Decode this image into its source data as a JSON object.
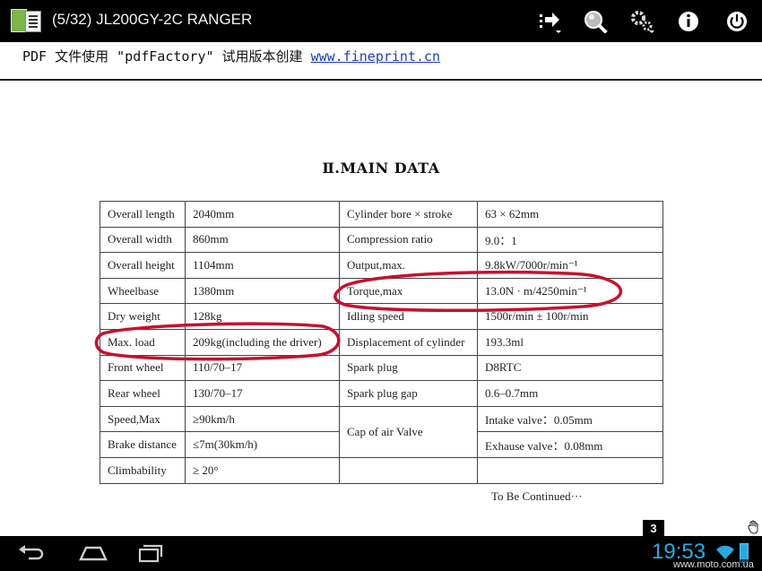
{
  "app": {
    "title": "(5/32) JL200GY-2C RANGER"
  },
  "toolbar": {
    "icons": [
      "goto-page-icon",
      "search-icon",
      "settings-icon",
      "info-icon",
      "power-icon"
    ]
  },
  "banner": {
    "text": "PDF 文件使用 \"pdfFactory\" 试用版本创建 ",
    "link": "www.fineprint.cn"
  },
  "document": {
    "title": "Ⅱ.MAIN DATA",
    "rows": [
      {
        "label1": "Overall length",
        "value1": "2040mm",
        "label2": "Cylinder bore × stroke",
        "value2": "63 × 62mm"
      },
      {
        "label1": "Overall width",
        "value1": "860mm",
        "label2": "Compression ratio",
        "value2": "9.0：1"
      },
      {
        "label1": "Overall height",
        "value1": "1104mm",
        "label2": "Output,max.",
        "value2": "9.8kW/7000r/min⁻¹"
      },
      {
        "label1": "Wheelbase",
        "value1": "1380mm",
        "label2": "Torque,max",
        "value2": "13.0N · m/4250min⁻¹"
      },
      {
        "label1": "Dry weight",
        "value1": "128kg",
        "label2": "Idling speed",
        "value2": "1500r/min ± 100r/min"
      },
      {
        "label1": "Max. load",
        "value1": "209kg(including the driver)",
        "label2": "Displacement  of  cylinder",
        "value2": "193.3ml"
      },
      {
        "label1": "Front wheel",
        "value1": "110/70–17",
        "label2": "Spark plug",
        "value2": "D8RTC"
      },
      {
        "label1": "Rear wheel",
        "value1": "130/70–17",
        "label2": "Spark plug gap",
        "value2": "0.6–0.7mm"
      },
      {
        "label1": "Speed,Max",
        "value1": "≥90km/h",
        "label2": "Cap of air Valve",
        "value2": "Intake valve：0.05mm"
      },
      {
        "label1": "Brake distance",
        "value1": "≤7m(30km/h)",
        "label2": "",
        "value2": "Exhause valve：0.08mm"
      },
      {
        "label1": "Climbability",
        "value1": "≥ 20°",
        "label2": "",
        "value2": ""
      }
    ],
    "continued": "To Be Continued···",
    "page_number": "3"
  },
  "status_bar": {
    "time": "19:53",
    "accent": "#2aa9e0"
  },
  "watermark": "www.moto.com.ua",
  "annotation_color": "#c8102e"
}
